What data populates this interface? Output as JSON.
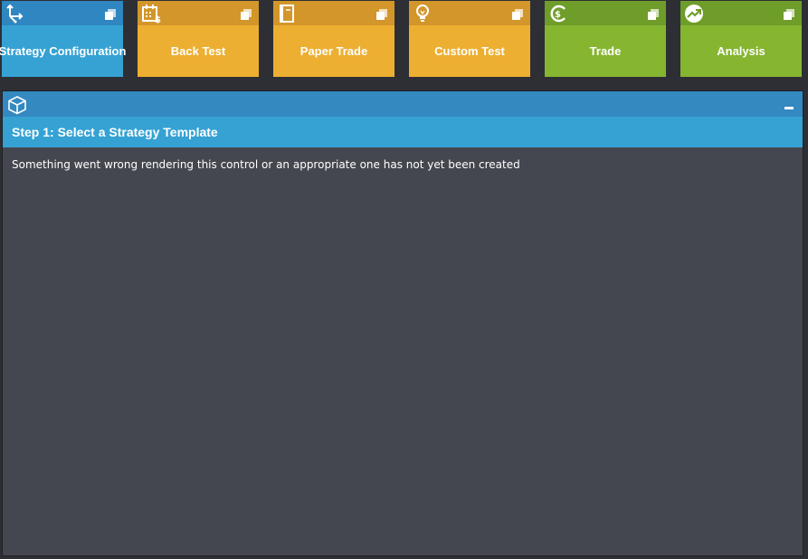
{
  "tiles": [
    {
      "label": "Strategy Configuration",
      "icon": "merge-arrows-icon",
      "head_color": "#2f86c0",
      "body_color": "#35a2d3"
    },
    {
      "label": "Back Test",
      "icon": "calendar-dollar-icon",
      "head_color": "#d3962b",
      "body_color": "#edaf31"
    },
    {
      "label": "Paper Trade",
      "icon": "notebook-icon",
      "head_color": "#d3962b",
      "body_color": "#edaf31"
    },
    {
      "label": "Custom Test",
      "icon": "lightbulb-icon",
      "head_color": "#d3962b",
      "body_color": "#edaf31"
    },
    {
      "label": "Trade",
      "icon": "dollar-circle-icon",
      "head_color": "#6f9d2a",
      "body_color": "#86b530"
    },
    {
      "label": "Analysis",
      "icon": "trend-up-icon",
      "head_color": "#6f9d2a",
      "body_color": "#86b530"
    }
  ],
  "panel": {
    "icon": "cube-icon",
    "step_title": "Step 1: Select a Strategy Template",
    "message": "Something went wrong rendering this control or an appropriate one has not yet been created"
  }
}
